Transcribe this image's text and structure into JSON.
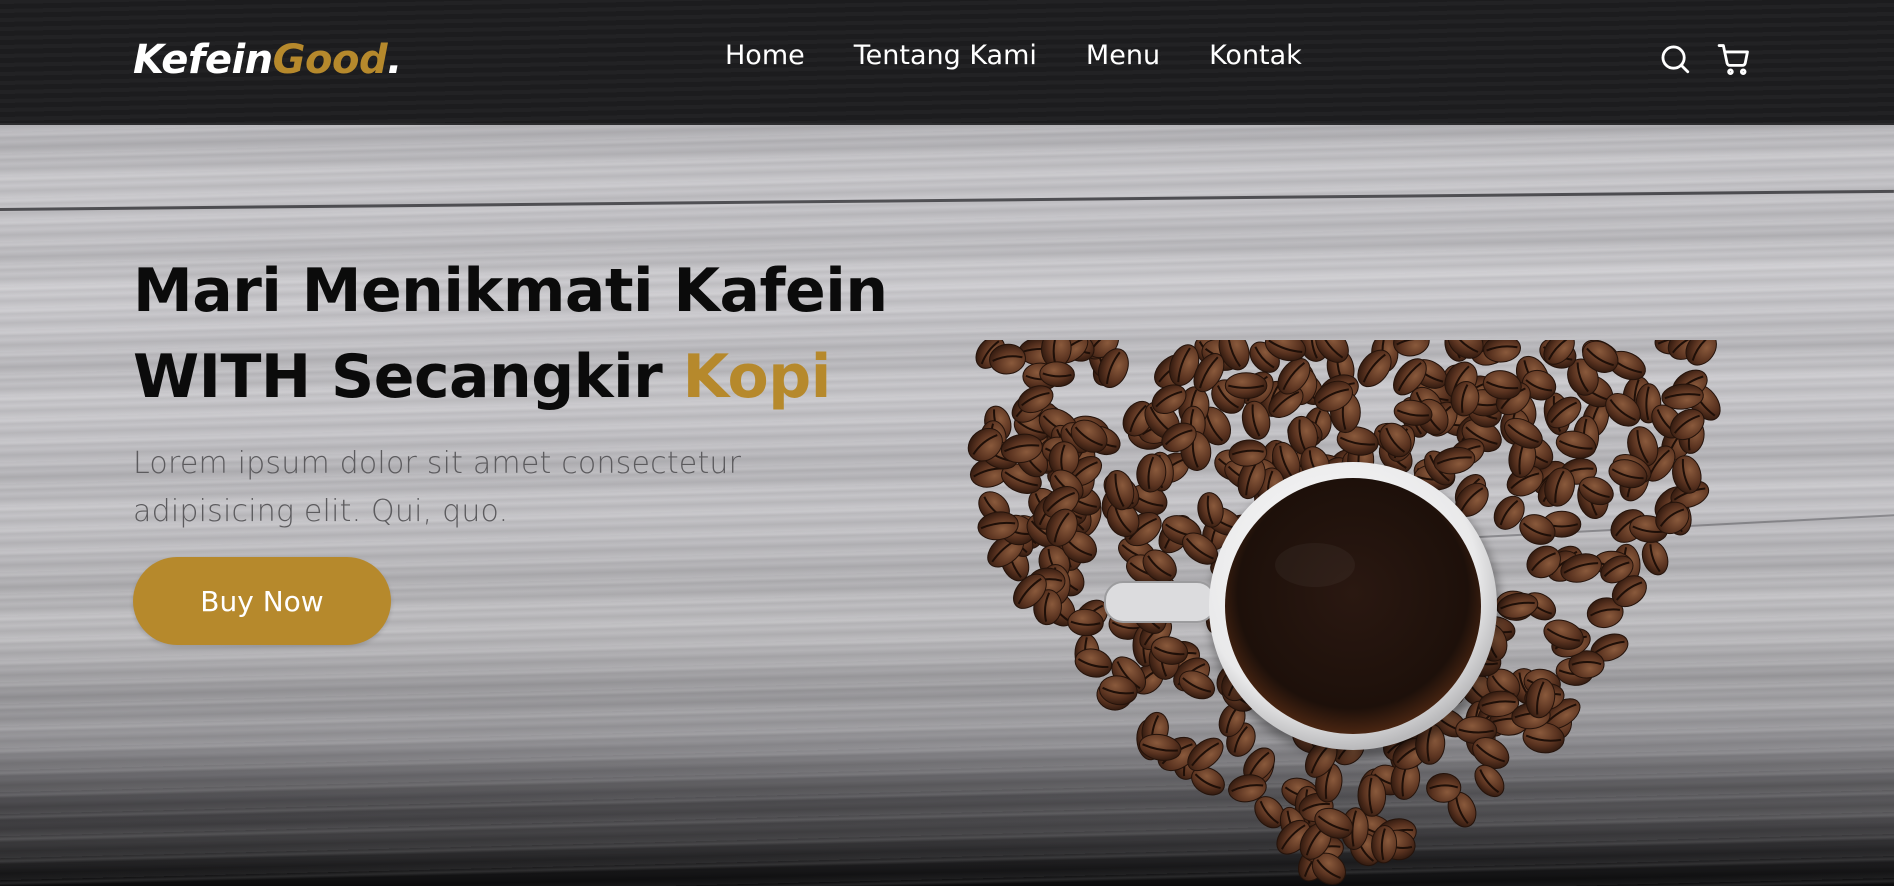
{
  "brand": {
    "name_main": "Kefein",
    "name_accent": "Good",
    "name_dot": ".",
    "accent_color": "#b6892c"
  },
  "nav": {
    "links": [
      {
        "label": "Home"
      },
      {
        "label": "Tentang Kami"
      },
      {
        "label": "Menu"
      },
      {
        "label": "Kontak"
      }
    ],
    "icons": [
      "search-icon",
      "shopping-cart-icon"
    ]
  },
  "hero": {
    "title_line1": "Mari Menikmati Kafein",
    "title_line2_main": "WITH Secangkir ",
    "title_line2_accent": "Kopi",
    "description": "Lorem ipsum dolor sit amet consectetur adipisicing elit. Qui, quo.",
    "cta_label": "Buy Now"
  },
  "colors": {
    "navbar_bg": "#1e1e20",
    "accent": "#b6892c",
    "title_text": "#0b0b0b"
  }
}
